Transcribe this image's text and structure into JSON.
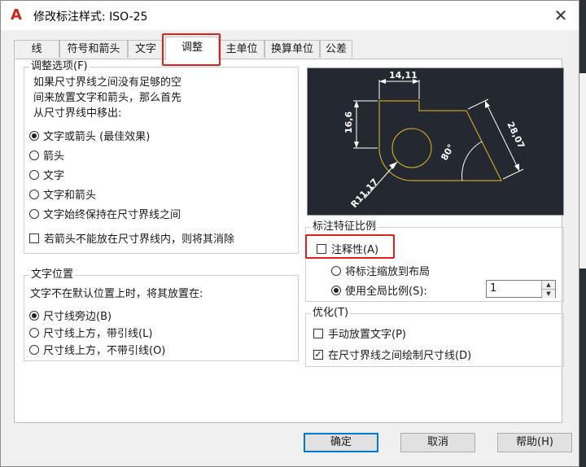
{
  "window": {
    "title": "修改标注样式: ISO-25",
    "close": "✕"
  },
  "tabs": [
    {
      "label": "线"
    },
    {
      "label": "符号和箭头"
    },
    {
      "label": "文字"
    },
    {
      "label": "调整"
    },
    {
      "label": "主单位"
    },
    {
      "label": "换算单位"
    },
    {
      "label": "公差"
    }
  ],
  "fit_options": {
    "legend": "调整选项(F)",
    "desc": [
      "如果尺寸界线之间没有足够的空",
      "间来放置文字和箭头，那么首先",
      "从尺寸界线中移出:"
    ],
    "radios": [
      {
        "label": "文字或箭头 (最佳效果)",
        "selected": true
      },
      {
        "label": "箭头",
        "selected": false
      },
      {
        "label": "文字",
        "selected": false
      },
      {
        "label": "文字和箭头",
        "selected": false
      },
      {
        "label": "文字始终保持在尺寸界线之间",
        "selected": false
      }
    ],
    "suppress_check": {
      "label": "若箭头不能放在尺寸界线内，则将其消除",
      "checked": false
    }
  },
  "text_placement": {
    "legend": "文字位置",
    "desc": "文字不在默认位置上时，将其放置在:",
    "radios": [
      {
        "label": "尺寸线旁边(B)",
        "selected": true
      },
      {
        "label": "尺寸线上方，带引线(L)",
        "selected": false
      },
      {
        "label": "尺寸线上方，不带引线(O)",
        "selected": false
      }
    ]
  },
  "preview": {
    "dims": [
      "14,11",
      "16,6",
      "28,07",
      "80°",
      "R11,17"
    ],
    "line_color": "#c9a227"
  },
  "scale": {
    "legend": "标注特征比例",
    "annotative": {
      "label": "注释性(A)",
      "checked": false
    },
    "radios": [
      {
        "label": "将标注缩放到布局",
        "selected": false
      },
      {
        "label": "使用全局比例(S):",
        "selected": true
      }
    ],
    "global_value": "1"
  },
  "fine_tuning": {
    "legend": "优化(T)",
    "checks": [
      {
        "label": "手动放置文字(P)",
        "checked": false
      },
      {
        "label": "在尺寸界线之间绘制尺寸线(D)",
        "checked": true
      }
    ]
  },
  "buttons": {
    "ok": "确定",
    "cancel": "取消",
    "help": "帮助(H)"
  },
  "colors": {
    "highlight": "#e0201b",
    "accent": "#0078d7"
  }
}
